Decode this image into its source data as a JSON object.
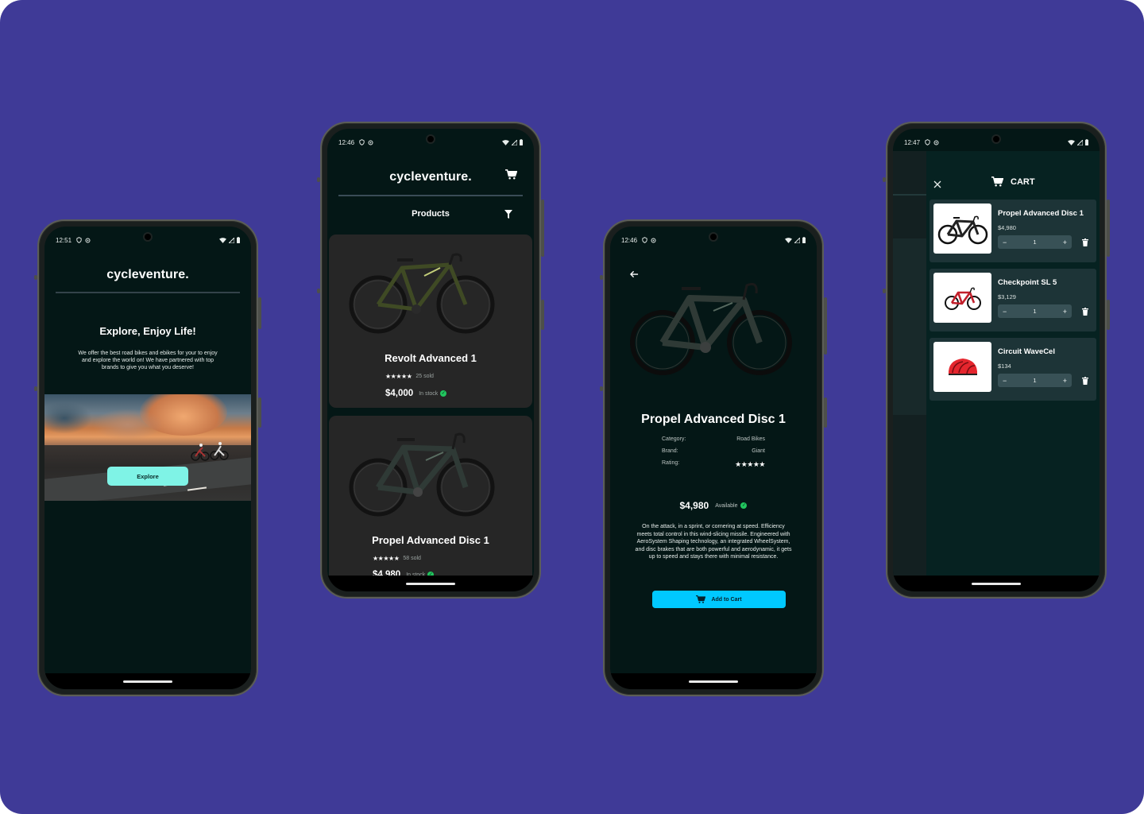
{
  "phones": {
    "home": {
      "time": "12:51",
      "brand": "cycleventure.",
      "headline": "Explore, Enjoy Life!",
      "blurb": "We offer the best road bikes and ebikes for your to enjoy and explore the world on! We have partnered with top brands to give you what you deserve!",
      "explore_label": "Explore"
    },
    "products": {
      "time": "12:46",
      "brand": "cycleventure.",
      "section_label": "Products",
      "items": [
        {
          "name": "Revolt Advanced 1",
          "stars": "★★★★★",
          "sold": "25 sold",
          "price": "$4,000",
          "stock": "In stock",
          "frame_color": "#3f4a24",
          "accent": "#c4cf7a"
        },
        {
          "name": "Propel Advanced Disc 1",
          "stars": "★★★★★",
          "sold": "58 sold",
          "price": "$4,980",
          "stock": "In stock",
          "frame_color": "#2f3a36",
          "accent": "#5a6e62"
        }
      ]
    },
    "detail": {
      "time": "12:46",
      "title": "Propel Advanced Disc 1",
      "specs": [
        {
          "label": "Category:",
          "value": "Road Bikes"
        },
        {
          "label": "Brand:",
          "value": "Giant"
        },
        {
          "label": "Rating:",
          "value": "★★★★★"
        }
      ],
      "price": "$4,980",
      "availability": "Available",
      "description": "On the attack, in a sprint, or cornering at speed. Efficiency meets total control in this wind-slicing missile. Engineered with AeroSystem Shaping technology, an integrated WheelSystem, and disc brakes that are both powerful and aerodynamic, it gets up to speed and stays there with minimal resistance.",
      "add_to_cart_label": "Add to Cart"
    },
    "cart": {
      "time": "12:47",
      "title": "CART",
      "items": [
        {
          "name": "Propel Advanced Disc 1",
          "price": "$4,980",
          "qty": "1",
          "thumb": "road-bike-black"
        },
        {
          "name": "Checkpoint SL 5",
          "price": "$3,129",
          "qty": "1",
          "thumb": "road-bike-red"
        },
        {
          "name": "Circuit WaveCel",
          "price": "$134",
          "qty": "1",
          "thumb": "helmet-red"
        }
      ]
    }
  },
  "colors": {
    "background": "#3f3a97",
    "screen": "#041716",
    "explore_button": "#7ff3e6",
    "add_to_cart_button": "#00c8ff",
    "in_stock": "#22c55e"
  },
  "icons": [
    "cart-icon",
    "filter-icon",
    "back-arrow-icon",
    "close-icon",
    "minus-icon",
    "plus-icon",
    "trash-icon",
    "check-circle-icon",
    "wifi-icon",
    "signal-icon",
    "battery-icon"
  ]
}
